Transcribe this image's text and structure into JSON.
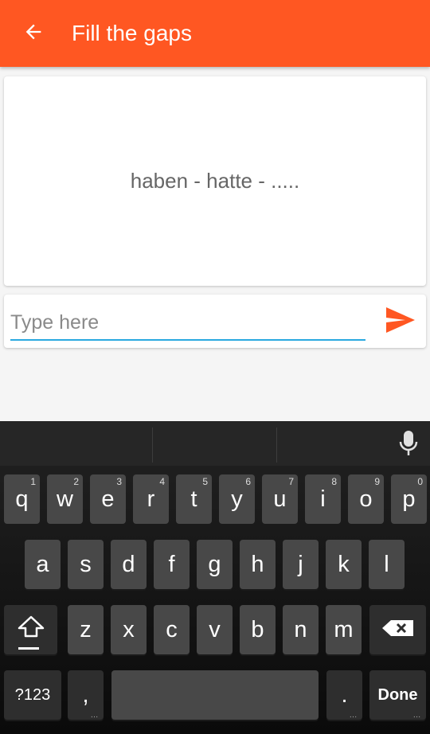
{
  "appbar": {
    "title": "Fill the gaps",
    "back_icon": "arrow-left-icon",
    "color": "#ff5722"
  },
  "question": {
    "text": "haben - hatte - ....."
  },
  "answer": {
    "value": "",
    "placeholder": "Type here",
    "underline_color": "#2aa9e0",
    "send_icon": "send-icon",
    "send_color": "#ff5722"
  },
  "keyboard": {
    "mic_icon": "microphone-icon",
    "row1": [
      {
        "label": "q",
        "hint": "1"
      },
      {
        "label": "w",
        "hint": "2"
      },
      {
        "label": "e",
        "hint": "3"
      },
      {
        "label": "r",
        "hint": "4"
      },
      {
        "label": "t",
        "hint": "5"
      },
      {
        "label": "y",
        "hint": "6"
      },
      {
        "label": "u",
        "hint": "7"
      },
      {
        "label": "i",
        "hint": "8"
      },
      {
        "label": "o",
        "hint": "9"
      },
      {
        "label": "p",
        "hint": "0"
      }
    ],
    "row2": [
      "a",
      "s",
      "d",
      "f",
      "g",
      "h",
      "j",
      "k",
      "l"
    ],
    "row3": [
      "z",
      "x",
      "c",
      "v",
      "b",
      "n",
      "m"
    ],
    "shift_icon": "shift-icon",
    "backspace_icon": "backspace-icon",
    "symbols_label": "?123",
    "comma_label": ",",
    "period_label": ".",
    "done_label": "Done"
  }
}
